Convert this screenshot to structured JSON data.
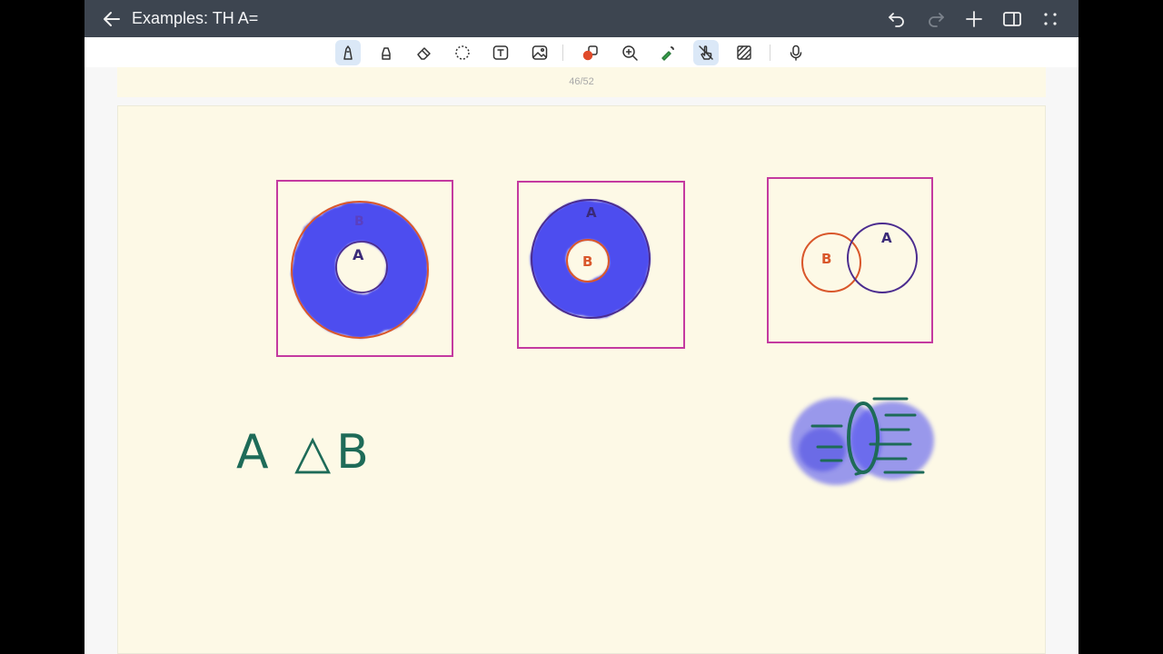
{
  "document": {
    "title": "Examples: TH A="
  },
  "page": {
    "indicator": "46/52"
  },
  "diagrams": {
    "d1": {
      "outer_label": "B",
      "inner_label": "A"
    },
    "d2": {
      "outer_label": "A",
      "inner_label": "B"
    },
    "d3": {
      "left_label": "B",
      "right_label": "A"
    }
  },
  "handwriting": {
    "expression": "A △B"
  },
  "colors": {
    "titlebar": "#3d4550",
    "paper": "#fdf9e6",
    "frame": "#c43aa0",
    "fill": "#3b3bf0",
    "set_b_stroke": "#d9572b",
    "set_a_stroke": "#4b2c8f",
    "ink_green": "#1e6b58",
    "active_tool": "#dbe8f7"
  },
  "icons": {
    "titlebar": [
      "back-arrow-icon",
      "undo-icon",
      "redo-icon",
      "add-page-icon",
      "sidebar-icon",
      "more-icon"
    ],
    "toolbar": [
      "pen-icon",
      "highlighter-icon",
      "eraser-icon",
      "lasso-icon",
      "text-icon",
      "image-icon",
      "shapes-icon",
      "zoom-icon",
      "laser-pointer-icon",
      "hand-touch-icon",
      "hatch-icon",
      "microphone-icon"
    ]
  }
}
